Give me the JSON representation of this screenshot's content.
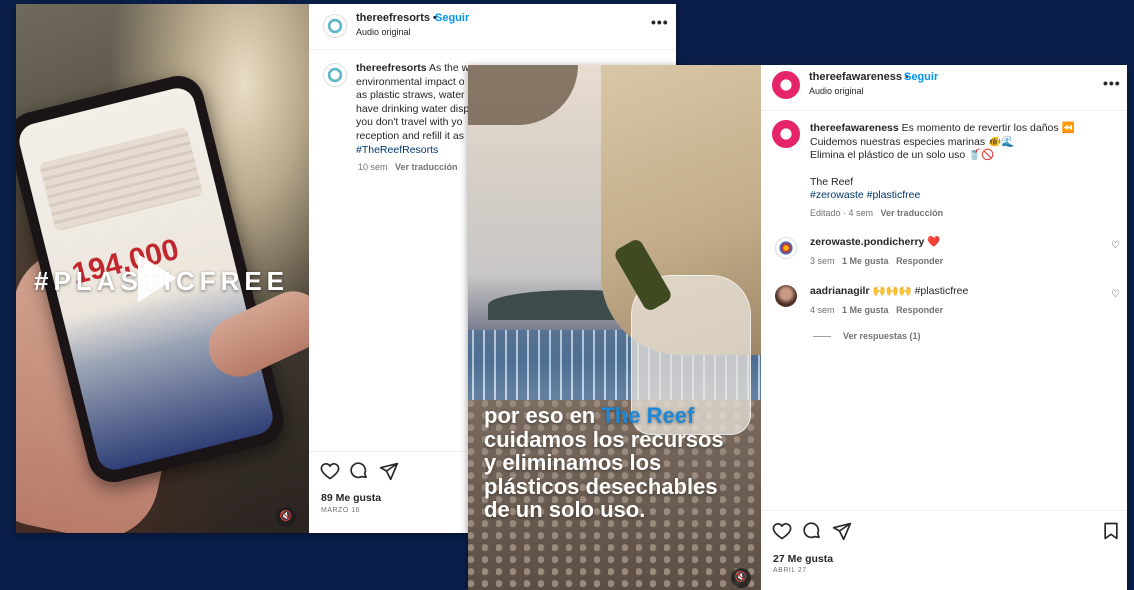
{
  "post1": {
    "username": "thereefresorts",
    "follow_label": "Seguir",
    "audio": "Audio original",
    "video_overlay": "#PLASTICFREE",
    "phone_number": "194,000",
    "caption_lines": [
      "As the w",
      "environmental impact o",
      "as plastic straws, water b",
      "have drinking water disp",
      "you don't travel with yo",
      "reception and refill it as"
    ],
    "caption_hashtag": "#TheReefResorts",
    "time_ago": "10 sem",
    "translate": "Ver traducción",
    "likes": "89 Me gusta",
    "date": "MARZO 16"
  },
  "post2": {
    "username": "thereefawareness",
    "follow_label": "Seguir",
    "audio": "Audio original",
    "caption_line1": "Es momento de revertir los daños ⏪",
    "caption_line2": "Cuidemos nuestras especies marinas 🐠🌊",
    "caption_line3": "Elimina el plástico de un solo uso 🥤🚫",
    "caption_line4": "The Reef",
    "caption_hashtags": "#zerowaste #plasticfree",
    "edited": "Editado · 4 sem",
    "translate": "Ver traducción",
    "video_text_pre": "por eso en ",
    "video_text_highlight": "The Reef",
    "video_text_rest": "\ncuidamos los recursos\ny eliminamos los\nplásticos desechables\nde un solo uso.",
    "comments": [
      {
        "username": "zerowaste.pondicherry",
        "text": "❤️",
        "time": "3 sem",
        "likes": "1 Me gusta",
        "reply": "Responder"
      },
      {
        "username": "aadrianagilr",
        "text": "🙌🙌🙌 #plasticfree",
        "time": "4 sem",
        "likes": "1 Me gusta",
        "reply": "Responder"
      }
    ],
    "view_replies": "Ver respuestas (1)",
    "likes": "27 Me gusta",
    "date": "ABRIL 27"
  },
  "colors": {
    "background": "#0a1f4a",
    "link_blue": "#0095f6",
    "hashtag": "#00376b",
    "highlight_text": "#1e88d6",
    "awareness_pink": "#e6246a"
  }
}
